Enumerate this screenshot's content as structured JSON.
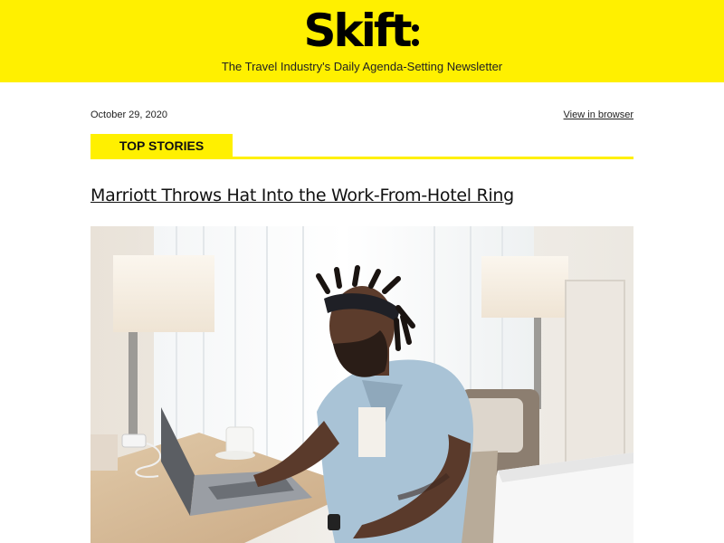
{
  "brand": {
    "logo_text": "Skift",
    "tagline": "The Travel Industry's Daily Agenda-Setting Newsletter",
    "accent_color": "#fff000"
  },
  "meta": {
    "date": "October 29, 2020",
    "view_in_browser": "View in browser"
  },
  "section": {
    "label": "TOP STORIES"
  },
  "story": {
    "headline": "Marriott Throws Hat Into the Work-From-Hotel Ring",
    "image": "man-working-on-laptop-in-hotel-room"
  }
}
